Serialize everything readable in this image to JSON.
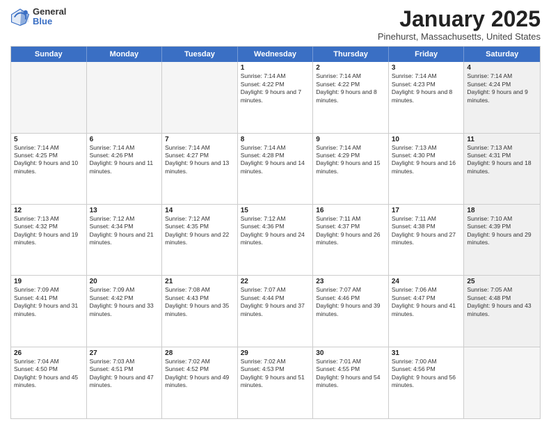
{
  "logo": {
    "general": "General",
    "blue": "Blue"
  },
  "header": {
    "month": "January 2025",
    "location": "Pinehurst, Massachusetts, United States"
  },
  "weekdays": [
    "Sunday",
    "Monday",
    "Tuesday",
    "Wednesday",
    "Thursday",
    "Friday",
    "Saturday"
  ],
  "weeks": [
    [
      {
        "day": "",
        "sunrise": "",
        "sunset": "",
        "daylight": "",
        "empty": true
      },
      {
        "day": "",
        "sunrise": "",
        "sunset": "",
        "daylight": "",
        "empty": true
      },
      {
        "day": "",
        "sunrise": "",
        "sunset": "",
        "daylight": "",
        "empty": true
      },
      {
        "day": "1",
        "sunrise": "Sunrise: 7:14 AM",
        "sunset": "Sunset: 4:22 PM",
        "daylight": "Daylight: 9 hours and 7 minutes."
      },
      {
        "day": "2",
        "sunrise": "Sunrise: 7:14 AM",
        "sunset": "Sunset: 4:22 PM",
        "daylight": "Daylight: 9 hours and 8 minutes."
      },
      {
        "day": "3",
        "sunrise": "Sunrise: 7:14 AM",
        "sunset": "Sunset: 4:23 PM",
        "daylight": "Daylight: 9 hours and 8 minutes."
      },
      {
        "day": "4",
        "sunrise": "Sunrise: 7:14 AM",
        "sunset": "Sunset: 4:24 PM",
        "daylight": "Daylight: 9 hours and 9 minutes.",
        "shade": true
      }
    ],
    [
      {
        "day": "5",
        "sunrise": "Sunrise: 7:14 AM",
        "sunset": "Sunset: 4:25 PM",
        "daylight": "Daylight: 9 hours and 10 minutes."
      },
      {
        "day": "6",
        "sunrise": "Sunrise: 7:14 AM",
        "sunset": "Sunset: 4:26 PM",
        "daylight": "Daylight: 9 hours and 11 minutes."
      },
      {
        "day": "7",
        "sunrise": "Sunrise: 7:14 AM",
        "sunset": "Sunset: 4:27 PM",
        "daylight": "Daylight: 9 hours and 13 minutes."
      },
      {
        "day": "8",
        "sunrise": "Sunrise: 7:14 AM",
        "sunset": "Sunset: 4:28 PM",
        "daylight": "Daylight: 9 hours and 14 minutes."
      },
      {
        "day": "9",
        "sunrise": "Sunrise: 7:14 AM",
        "sunset": "Sunset: 4:29 PM",
        "daylight": "Daylight: 9 hours and 15 minutes."
      },
      {
        "day": "10",
        "sunrise": "Sunrise: 7:13 AM",
        "sunset": "Sunset: 4:30 PM",
        "daylight": "Daylight: 9 hours and 16 minutes."
      },
      {
        "day": "11",
        "sunrise": "Sunrise: 7:13 AM",
        "sunset": "Sunset: 4:31 PM",
        "daylight": "Daylight: 9 hours and 18 minutes.",
        "shade": true
      }
    ],
    [
      {
        "day": "12",
        "sunrise": "Sunrise: 7:13 AM",
        "sunset": "Sunset: 4:32 PM",
        "daylight": "Daylight: 9 hours and 19 minutes."
      },
      {
        "day": "13",
        "sunrise": "Sunrise: 7:12 AM",
        "sunset": "Sunset: 4:34 PM",
        "daylight": "Daylight: 9 hours and 21 minutes."
      },
      {
        "day": "14",
        "sunrise": "Sunrise: 7:12 AM",
        "sunset": "Sunset: 4:35 PM",
        "daylight": "Daylight: 9 hours and 22 minutes."
      },
      {
        "day": "15",
        "sunrise": "Sunrise: 7:12 AM",
        "sunset": "Sunset: 4:36 PM",
        "daylight": "Daylight: 9 hours and 24 minutes."
      },
      {
        "day": "16",
        "sunrise": "Sunrise: 7:11 AM",
        "sunset": "Sunset: 4:37 PM",
        "daylight": "Daylight: 9 hours and 26 minutes."
      },
      {
        "day": "17",
        "sunrise": "Sunrise: 7:11 AM",
        "sunset": "Sunset: 4:38 PM",
        "daylight": "Daylight: 9 hours and 27 minutes."
      },
      {
        "day": "18",
        "sunrise": "Sunrise: 7:10 AM",
        "sunset": "Sunset: 4:39 PM",
        "daylight": "Daylight: 9 hours and 29 minutes.",
        "shade": true
      }
    ],
    [
      {
        "day": "19",
        "sunrise": "Sunrise: 7:09 AM",
        "sunset": "Sunset: 4:41 PM",
        "daylight": "Daylight: 9 hours and 31 minutes."
      },
      {
        "day": "20",
        "sunrise": "Sunrise: 7:09 AM",
        "sunset": "Sunset: 4:42 PM",
        "daylight": "Daylight: 9 hours and 33 minutes."
      },
      {
        "day": "21",
        "sunrise": "Sunrise: 7:08 AM",
        "sunset": "Sunset: 4:43 PM",
        "daylight": "Daylight: 9 hours and 35 minutes."
      },
      {
        "day": "22",
        "sunrise": "Sunrise: 7:07 AM",
        "sunset": "Sunset: 4:44 PM",
        "daylight": "Daylight: 9 hours and 37 minutes."
      },
      {
        "day": "23",
        "sunrise": "Sunrise: 7:07 AM",
        "sunset": "Sunset: 4:46 PM",
        "daylight": "Daylight: 9 hours and 39 minutes."
      },
      {
        "day": "24",
        "sunrise": "Sunrise: 7:06 AM",
        "sunset": "Sunset: 4:47 PM",
        "daylight": "Daylight: 9 hours and 41 minutes."
      },
      {
        "day": "25",
        "sunrise": "Sunrise: 7:05 AM",
        "sunset": "Sunset: 4:48 PM",
        "daylight": "Daylight: 9 hours and 43 minutes.",
        "shade": true
      }
    ],
    [
      {
        "day": "26",
        "sunrise": "Sunrise: 7:04 AM",
        "sunset": "Sunset: 4:50 PM",
        "daylight": "Daylight: 9 hours and 45 minutes."
      },
      {
        "day": "27",
        "sunrise": "Sunrise: 7:03 AM",
        "sunset": "Sunset: 4:51 PM",
        "daylight": "Daylight: 9 hours and 47 minutes."
      },
      {
        "day": "28",
        "sunrise": "Sunrise: 7:02 AM",
        "sunset": "Sunset: 4:52 PM",
        "daylight": "Daylight: 9 hours and 49 minutes."
      },
      {
        "day": "29",
        "sunrise": "Sunrise: 7:02 AM",
        "sunset": "Sunset: 4:53 PM",
        "daylight": "Daylight: 9 hours and 51 minutes."
      },
      {
        "day": "30",
        "sunrise": "Sunrise: 7:01 AM",
        "sunset": "Sunset: 4:55 PM",
        "daylight": "Daylight: 9 hours and 54 minutes."
      },
      {
        "day": "31",
        "sunrise": "Sunrise: 7:00 AM",
        "sunset": "Sunset: 4:56 PM",
        "daylight": "Daylight: 9 hours and 56 minutes."
      },
      {
        "day": "",
        "sunrise": "",
        "sunset": "",
        "daylight": "",
        "empty": true,
        "shade": true
      }
    ]
  ]
}
